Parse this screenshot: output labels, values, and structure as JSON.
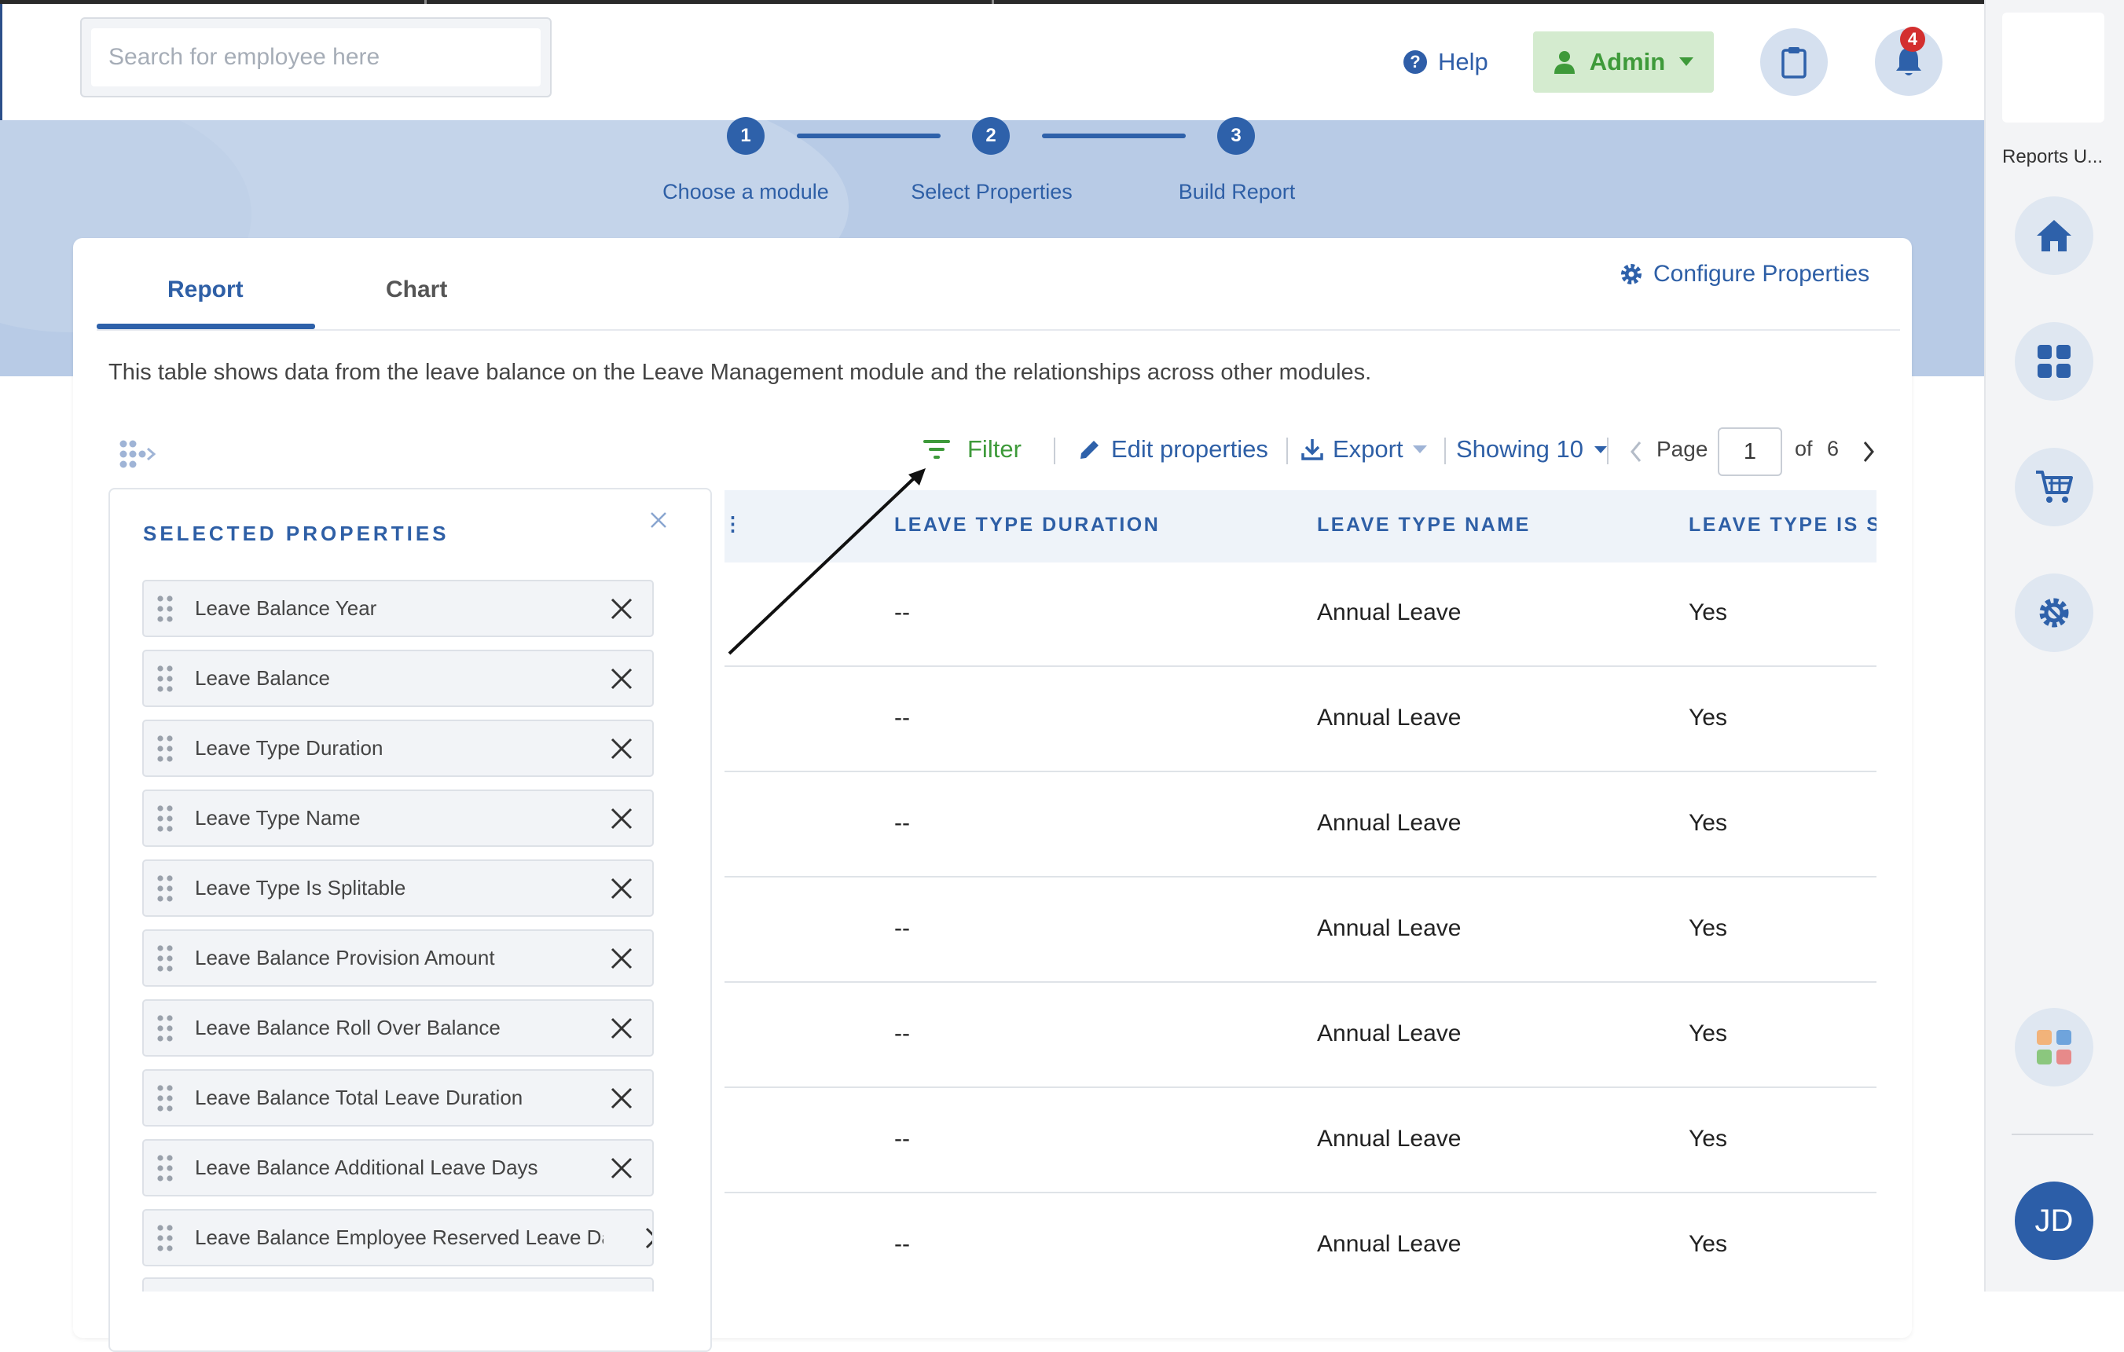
{
  "header": {
    "search_placeholder": "Search for employee here",
    "help_label": "Help",
    "admin_label": "Admin",
    "notification_count": "4"
  },
  "stepper": {
    "steps": [
      {
        "number": "1",
        "label": "Choose a module"
      },
      {
        "number": "2",
        "label": "Select Properties"
      },
      {
        "number": "3",
        "label": "Build Report"
      }
    ]
  },
  "tabs": {
    "report": "Report",
    "chart": "Chart",
    "active": "Report"
  },
  "configure_label": "Configure Properties",
  "description": "This table shows data from the leave balance on the Leave Management module and the relationships across other modules.",
  "toolbar": {
    "filter": "Filter",
    "edit": "Edit properties",
    "export": "Export",
    "showing": "Showing 10",
    "page_label": "Page",
    "page_value": "1",
    "of_label": "of",
    "total_pages": "6"
  },
  "table": {
    "columns": [
      "LEAVE TYPE DURATION",
      "LEAVE TYPE NAME",
      "LEAVE TYPE IS S"
    ],
    "rows": [
      [
        "--",
        "Annual Leave",
        "Yes"
      ],
      [
        "--",
        "Annual Leave",
        "Yes"
      ],
      [
        "--",
        "Annual Leave",
        "Yes"
      ],
      [
        "--",
        "Annual Leave",
        "Yes"
      ],
      [
        "--",
        "Annual Leave",
        "Yes"
      ],
      [
        "--",
        "Annual Leave",
        "Yes"
      ],
      [
        "--",
        "Annual Leave",
        "Yes"
      ]
    ]
  },
  "selected_properties": {
    "title": "SELECTED PROPERTIES",
    "items": [
      "Leave Balance Year",
      "Leave Balance",
      "Leave Type Duration",
      "Leave Type Name",
      "Leave Type Is Splitable",
      "Leave Balance Provision Amount",
      "Leave Balance Roll Over Balance",
      "Leave Balance Total Leave Duration",
      "Leave Balance Additional Leave Days",
      "Leave Balance Employee Reserved Leave Da..."
    ]
  },
  "sidebar": {
    "title": "Reports U...",
    "buttons": [
      "home-icon",
      "grid-icon",
      "cart-icon",
      "settings-icon",
      "apps-icon"
    ],
    "avatar_initials": "JD"
  },
  "colors": {
    "primary": "#2e61aa",
    "hero": "#b8cbe6",
    "admin_bg": "#d4ebcf",
    "admin_text": "#3e9a3a",
    "filter_green": "#3e9a3a",
    "badge_red": "#d32f2f"
  }
}
